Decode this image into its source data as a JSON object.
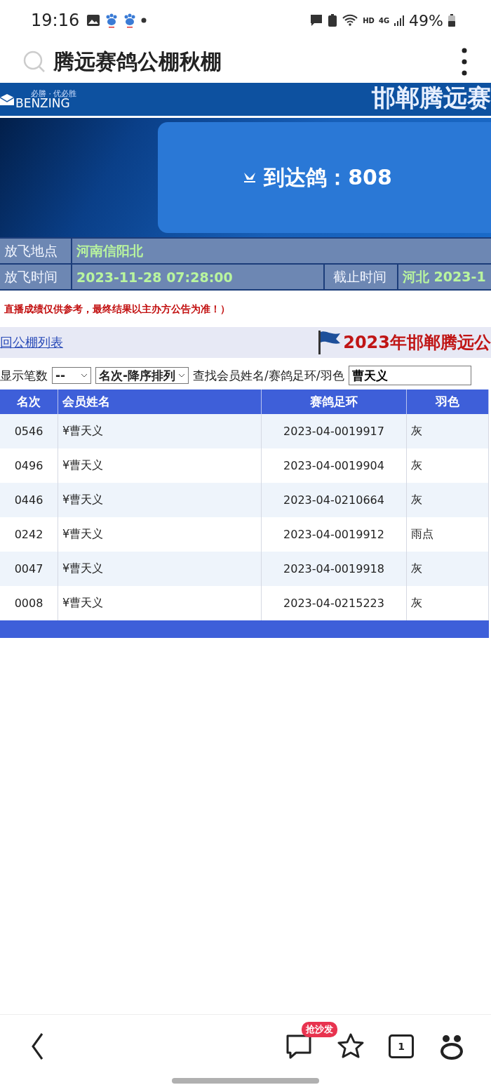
{
  "status_bar": {
    "time": "19:16",
    "network": "4G",
    "battery": "49%",
    "hd": "HD"
  },
  "search_bar": {
    "query": "腾远赛鸽公棚秋棚"
  },
  "site_header": {
    "logo_slogan": "必勝 · 优必胜",
    "logo_name": "BENZING",
    "title": "邯郸腾远赛"
  },
  "hero": {
    "arrived_label": "到达鸽：808"
  },
  "race_info": [
    {
      "label": "放飞地点",
      "value": "河南信阳北"
    },
    {
      "label": "放飞时间",
      "value": "2023-11-28 07:28:00",
      "label_2": "截止时间",
      "value_2": "河北  2023-1"
    }
  ],
  "notice": "直播成绩仅供参考，最终结果以主办方公告为准！）",
  "link_bar": {
    "back_link": "回公棚列表",
    "race_title": "2023年邯郸腾远公"
  },
  "filters": {
    "count_label": "显示笔数",
    "count_value": "--",
    "sort_value": "名次-降序排列",
    "search_label": "查找会员姓名/赛鸽足环/羽色",
    "search_value": "曹天义"
  },
  "table": {
    "columns": [
      "名次",
      "会员姓名",
      "赛鸽足环",
      "羽色"
    ],
    "rows": [
      {
        "rank": "0546",
        "member": "¥曹天义",
        "ring": "2023-04-0019917",
        "plumage": "灰"
      },
      {
        "rank": "0496",
        "member": "¥曹天义",
        "ring": "2023-04-0019904",
        "plumage": "灰"
      },
      {
        "rank": "0446",
        "member": "¥曹天义",
        "ring": "2023-04-0210664",
        "plumage": "灰"
      },
      {
        "rank": "0242",
        "member": "¥曹天义",
        "ring": "2023-04-0019912",
        "plumage": "雨点"
      },
      {
        "rank": "0047",
        "member": "¥曹天义",
        "ring": "2023-04-0019918",
        "plumage": "灰"
      },
      {
        "rank": "0008",
        "member": "¥曹天义",
        "ring": "2023-04-0215223",
        "plumage": "灰"
      }
    ]
  },
  "bottom_nav": {
    "comment_badge": "抢沙发",
    "tab_count": "1"
  }
}
